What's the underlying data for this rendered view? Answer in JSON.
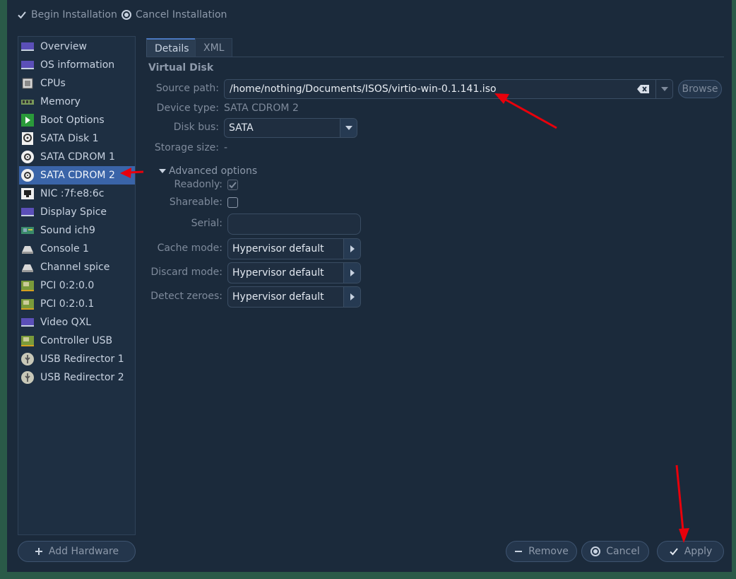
{
  "toolbar": {
    "begin_label": "Begin Installation",
    "cancel_label": "Cancel Installation"
  },
  "sidebar": {
    "items": [
      {
        "label": "Overview",
        "icon": "monitor-icon"
      },
      {
        "label": "OS information",
        "icon": "monitor-icon"
      },
      {
        "label": "CPUs",
        "icon": "cpu-icon"
      },
      {
        "label": "Memory",
        "icon": "memory-icon"
      },
      {
        "label": "Boot Options",
        "icon": "boot-icon"
      },
      {
        "label": "SATA Disk 1",
        "icon": "disk-icon"
      },
      {
        "label": "SATA CDROM 1",
        "icon": "cdrom-icon"
      },
      {
        "label": "SATA CDROM 2",
        "icon": "cdrom-icon",
        "selected": true
      },
      {
        "label": "NIC :7f:e8:6c",
        "icon": "network-icon"
      },
      {
        "label": "Display Spice",
        "icon": "display-icon"
      },
      {
        "label": "Sound ich9",
        "icon": "sound-card-icon"
      },
      {
        "label": "Console 1",
        "icon": "serial-icon"
      },
      {
        "label": "Channel spice",
        "icon": "serial-icon"
      },
      {
        "label": "PCI 0:2:0.0",
        "icon": "pci-icon"
      },
      {
        "label": "PCI 0:2:0.1",
        "icon": "pci-icon"
      },
      {
        "label": "Video QXL",
        "icon": "display-icon"
      },
      {
        "label": "Controller USB",
        "icon": "pci-icon"
      },
      {
        "label": "USB Redirector 1",
        "icon": "usb-icon"
      },
      {
        "label": "USB Redirector 2",
        "icon": "usb-icon"
      }
    ],
    "add_hardware_label": "Add Hardware"
  },
  "tabs": [
    {
      "label": "Details",
      "active": true
    },
    {
      "label": "XML",
      "active": false
    }
  ],
  "details": {
    "section_title": "Virtual Disk",
    "source_path_label": "Source path:",
    "source_path_value": "/home/nothing/Documents/ISOS/virtio-win-0.1.141.iso",
    "browse_label": "Browse",
    "device_type_label": "Device type:",
    "device_type_value": "SATA CDROM 2",
    "disk_bus_label": "Disk bus:",
    "disk_bus_value": "SATA",
    "storage_size_label": "Storage size:",
    "storage_size_value": "-",
    "advanced_label": "Advanced options",
    "readonly_label": "Readonly:",
    "readonly_checked": true,
    "shareable_label": "Shareable:",
    "shareable_checked": false,
    "serial_label": "Serial:",
    "serial_value": "",
    "cache_mode_label": "Cache mode:",
    "cache_mode_value": "Hypervisor default",
    "discard_mode_label": "Discard mode:",
    "discard_mode_value": "Hypervisor default",
    "detect_zeroes_label": "Detect zeroes:",
    "detect_zeroes_value": "Hypervisor default"
  },
  "actions": {
    "remove_label": "Remove",
    "cancel_label": "Cancel",
    "apply_label": "Apply"
  },
  "colors": {
    "selection": "#3a64a8",
    "annotation_arrow": "#e8000b"
  }
}
